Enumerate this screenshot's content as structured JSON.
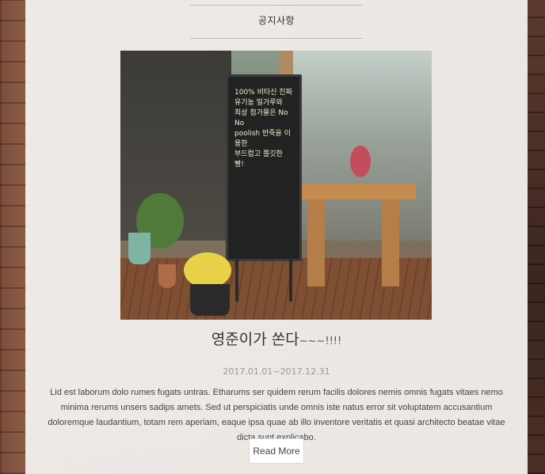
{
  "section": {
    "title": "공지사항"
  },
  "post": {
    "image": {
      "board_text": "100% 비타신 진짜\n유기농 밀가루와\n최상 첨가물은 No No\npoolish 반죽을 이용한\n부드럽고 쫄깃한\n빵!"
    },
    "title": "영준이가 쏜다",
    "title_tail": "~~~!!!!",
    "date_range": "2017.01.01~2017.12.31",
    "body": "Lid est laborum dolo rumes fugats untras. Etharums ser quidem rerum facilis dolores nemis omnis fugats vitaes nemo minima rerums unsers sadips amets. Sed ut perspiciatis unde omnis iste natus error sit voluptatem accusantium doloremque laudantium, totam rem aperiam, eaque ipsa quae ab illo inventore veritatis et quasi architecto beatae vitae dicta sunt explicabo.",
    "read_more_label": "Read More"
  }
}
